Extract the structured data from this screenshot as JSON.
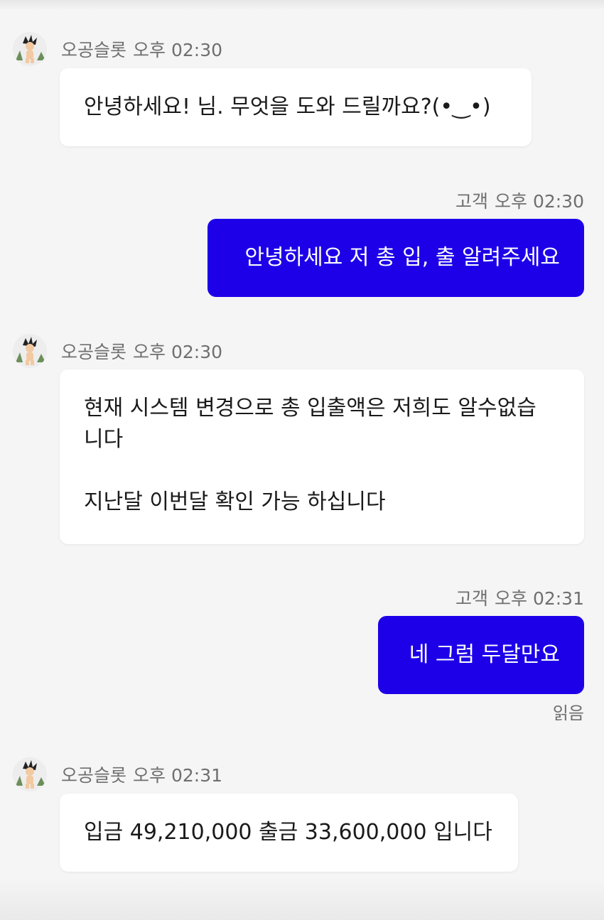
{
  "messages": [
    {
      "sender": "오공슬롯",
      "time": "오후 02:30",
      "text": "안녕하세요! 님. 무엇을 도와 드릴까요?(•‿•)"
    },
    {
      "sender": "고객",
      "time": "오후 02:30",
      "text": "안녕하세요 저 총 입, 출 알려주세요"
    },
    {
      "sender": "오공슬롯",
      "time": "오후 02:30",
      "text": "현재 시스템 변경으로 총 입출액은 저희도 알수없습\n니다\n\n지난달 이번달 확인 가능 하십니다"
    },
    {
      "sender": "고객",
      "time": "오후 02:31",
      "text": "네 그럼 두달만요",
      "status": "읽음"
    },
    {
      "sender": "오공슬롯",
      "time": "오후 02:31",
      "text": "입금 49,210,000 출금 33,600,000 입니다"
    }
  ],
  "colors": {
    "background": "#f5f5f5",
    "outgoing_bubble": "#1d00e8",
    "incoming_bubble": "#ffffff",
    "meta_text": "#6f6f6f"
  },
  "icons": {
    "agent_avatar": "cartoon-character-avatar"
  }
}
